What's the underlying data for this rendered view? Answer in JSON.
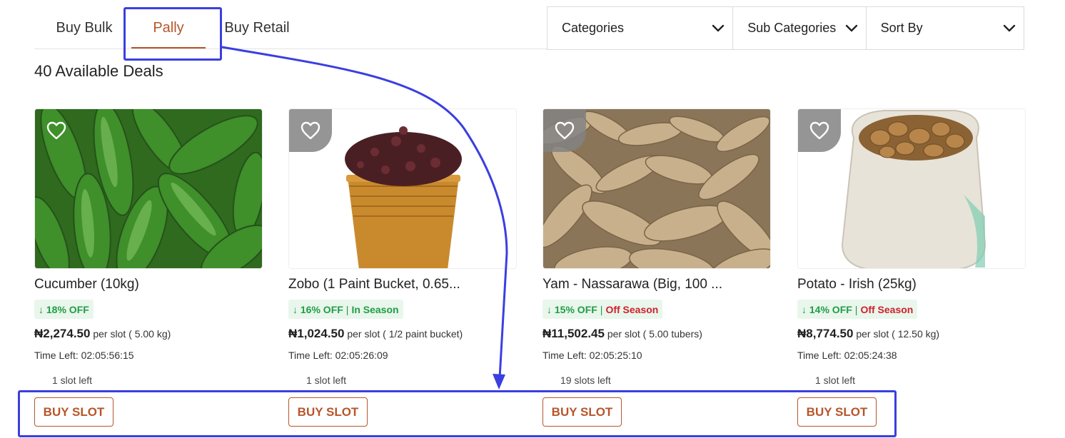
{
  "tabs": [
    {
      "label": "Buy Bulk"
    },
    {
      "label": "Pally",
      "active": true
    },
    {
      "label": "Buy Retail"
    }
  ],
  "filters": {
    "categories": "Categories",
    "sub_categories": "Sub Categories",
    "sort_by": "Sort By"
  },
  "deals_count": "40 Available Deals",
  "colors": {
    "accent": "#b5562b",
    "discount_green": "#1f9d45",
    "off_season_red": "#d0202c",
    "annotation_blue": "#3a3fe0"
  },
  "products": [
    {
      "name": "Cucumber (10kg)",
      "discount": "↓ 18% OFF",
      "season": "",
      "price": "₦2,274.50",
      "unit": "per slot ( 5.00 kg)",
      "time_left": "Time Left: 02:05:56:15",
      "slots_left": "1 slot left",
      "button": "BUY SLOT",
      "icon": "heart-outline-icon"
    },
    {
      "name": "Zobo (1 Paint Bucket, 0.65...",
      "discount": "↓ 16% OFF",
      "season": "In Season",
      "price": "₦1,024.50",
      "unit": "per slot ( 1/2 paint bucket)",
      "time_left": "Time Left: 02:05:26:09",
      "slots_left": "1 slot left",
      "button": "BUY SLOT",
      "icon": "heart-outline-icon"
    },
    {
      "name": "Yam - Nassarawa (Big, 100 ...",
      "discount": "↓ 15% OFF",
      "season": "Off Season",
      "price": "₦11,502.45",
      "unit": "per slot ( 5.00 tubers)",
      "time_left": "Time Left: 02:05:25:10",
      "slots_left": "19 slots left",
      "button": "BUY SLOT",
      "icon": "heart-outline-icon"
    },
    {
      "name": "Potato - Irish (25kg)",
      "discount": "↓ 14% OFF",
      "season": "Off Season",
      "price": "₦8,774.50",
      "unit": "per slot ( 12.50 kg)",
      "time_left": "Time Left: 02:05:24:38",
      "slots_left": "1 slot left",
      "button": "BUY SLOT",
      "icon": "heart-outline-icon"
    }
  ]
}
